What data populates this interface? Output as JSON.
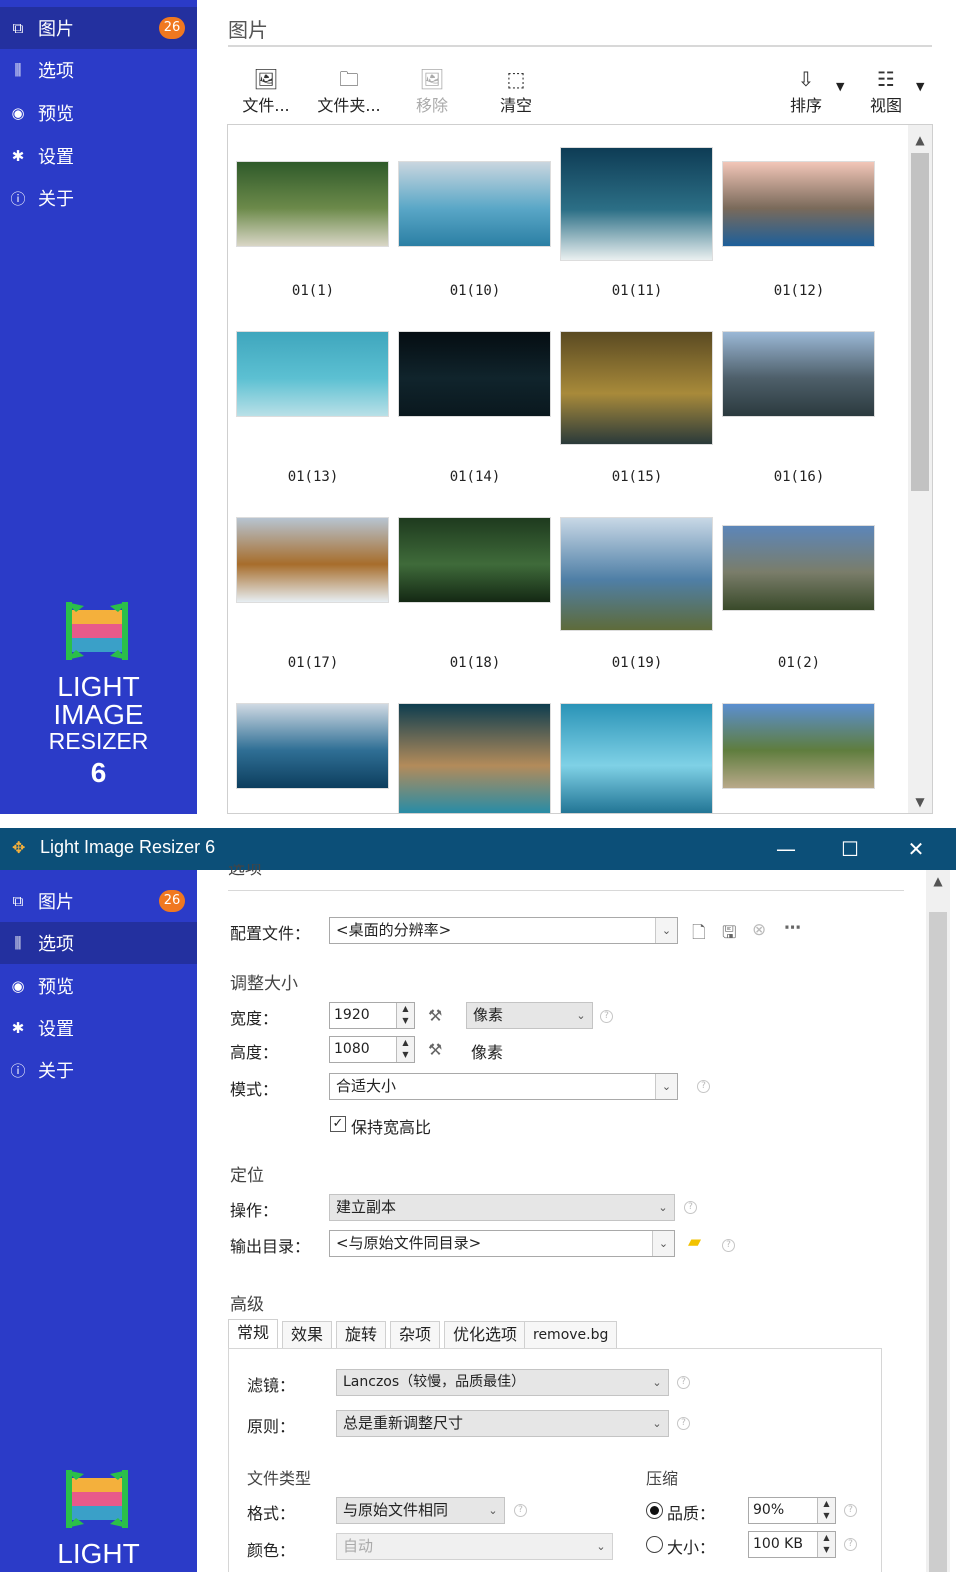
{
  "window1": {
    "sidebar": {
      "items": [
        {
          "icon": "images-icon",
          "label": "图片",
          "badge": "26",
          "active": true
        },
        {
          "icon": "sliders-icon",
          "label": "选项"
        },
        {
          "icon": "eye-icon",
          "label": "预览"
        },
        {
          "icon": "gear-icon",
          "label": "设置"
        },
        {
          "icon": "info-icon",
          "label": "关于"
        }
      ],
      "logo": {
        "line1": "LIGHT",
        "line2": "IMAGE",
        "line3": "RESIZER",
        "version": "6"
      }
    },
    "page_title": "图片",
    "toolbar": {
      "add_files": "文件...",
      "add_folder": "文件夹...",
      "remove": "移除",
      "clear": "清空",
      "sort": "排序",
      "view": "视图"
    },
    "thumbnails": [
      {
        "caption": "01(1)",
        "colors": [
          "#2f5a2a",
          "#6c8a4a",
          "#d9d6c6"
        ]
      },
      {
        "caption": "01(10)",
        "colors": [
          "#c9d6df",
          "#5aa7c7",
          "#2b7fa4"
        ]
      },
      {
        "caption": "01(11)",
        "colors": [
          "#0e3c55",
          "#2c6f86",
          "#eaf0f0"
        ]
      },
      {
        "caption": "01(12)",
        "colors": [
          "#f2c6b8",
          "#7a6a5a",
          "#1d5f9a"
        ]
      },
      {
        "caption": "01(13)",
        "colors": [
          "#3fa6bd",
          "#5cc0d2",
          "#b9e0e7"
        ]
      },
      {
        "caption": "01(14)",
        "colors": [
          "#050d12",
          "#10242c",
          "#0a181e"
        ]
      },
      {
        "caption": "01(15)",
        "colors": [
          "#5a4a22",
          "#a88a3a",
          "#2a3a3a"
        ]
      },
      {
        "caption": "01(16)",
        "colors": [
          "#9bb8d6",
          "#4e5f6a",
          "#2b3a3e"
        ]
      },
      {
        "caption": "01(17)",
        "colors": [
          "#b7c4d1",
          "#a76d2b",
          "#e7eef2"
        ]
      },
      {
        "caption": "01(18)",
        "colors": [
          "#1e3a1e",
          "#3f6b3a",
          "#142814"
        ]
      },
      {
        "caption": "01(19)",
        "colors": [
          "#c8d8e6",
          "#4f7fa6",
          "#5e6b3a"
        ]
      },
      {
        "caption": "01(2)",
        "colors": [
          "#5c86b9",
          "#7a7d6a",
          "#394a2a"
        ]
      },
      {
        "caption": "",
        "colors": [
          "#cfd9e3",
          "#2f6f95",
          "#0d3e5e"
        ]
      },
      {
        "caption": "",
        "colors": [
          "#0e3d4f",
          "#b38b5a",
          "#1f8cab"
        ]
      },
      {
        "caption": "",
        "colors": [
          "#2a93b7",
          "#7fd1e6",
          "#1c6f90"
        ]
      },
      {
        "caption": "",
        "colors": [
          "#5b8fd0",
          "#5f7d3e",
          "#b9a98a"
        ]
      }
    ]
  },
  "window2": {
    "title": "Light Image Resizer 6",
    "section_heading": "选项",
    "profile_label": "配置文件：",
    "profile_value": "<桌面的分辨率>",
    "resize_heading": "调整大小",
    "width_label": "宽度：",
    "width_value": "1920",
    "height_label": "高度：",
    "height_value": "1080",
    "unit_value": "像素",
    "unit_text": "像素",
    "mode_label": "模式：",
    "mode_value": "合适大小",
    "keep_ratio_label": "保持宽高比",
    "keep_ratio_checked": true,
    "target_heading": "定位",
    "action_label": "操作：",
    "action_value": "建立副本",
    "output_label": "输出目录：",
    "output_value": "<与原始文件同目录>",
    "advanced_heading": "高级",
    "tabs": [
      "常规",
      "效果",
      "旋转",
      "杂项",
      "优化选项",
      "remove.bg"
    ],
    "filter_label": "滤镜：",
    "filter_value": "Lanczos（较慢，品质最佳）",
    "rule_label": "原则：",
    "rule_value": "总是重新调整尺寸",
    "filetype_heading": "文件类型",
    "format_label": "格式：",
    "format_value": "与原始文件相同",
    "color_label": "颜色：",
    "color_value": "自动",
    "compression_heading": "压缩",
    "quality_label": "品质：",
    "quality_value": "90%",
    "size_label": "大小：",
    "size_value": "100 KB",
    "window_buttons": {
      "minimize": "—",
      "maximize": "☐",
      "close": "✕"
    }
  },
  "colors": {
    "sidebar": "#2b3bc8",
    "sidebar_active": "#23309f",
    "badge": "#f07820",
    "titlebar": "#0c4f78"
  }
}
